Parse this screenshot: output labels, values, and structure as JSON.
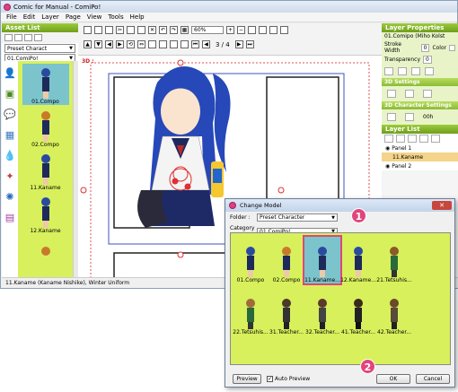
{
  "window": {
    "title": "Comic for Manual - ComiPo!"
  },
  "menu": [
    "File",
    "Edit",
    "Layer",
    "Page",
    "View",
    "Tools",
    "Help"
  ],
  "asset_list": {
    "header": "Asset List",
    "folder_select": "Preset Charact",
    "category_select": "01.ComiPo!",
    "thumbs": [
      "01.Compo",
      "02.Compo",
      "11.Kaname",
      "12.Kaname",
      ""
    ],
    "selected_thumb": "01.Compo"
  },
  "toolbar": {
    "zoom": "60%",
    "page": "3 / 4",
    "label_3d": "3D :"
  },
  "layer_properties": {
    "header": "Layer Properties",
    "layer_name": "01.Comipo (Miho Kolst",
    "stroke_width_label": "Stroke Width",
    "stroke_width_value": "0",
    "color_label": "Color",
    "transparency_label": "Transparency",
    "transparency_value": "0",
    "settings_3d": "3D Settings",
    "char_settings_3d": "3D Character Settings",
    "num_label": "00h"
  },
  "layer_list": {
    "header": "Layer List",
    "items": [
      "Panel 1",
      "11.Kaname",
      "Panel 2"
    ]
  },
  "status": "11.Kaname (Kaname Nishike), Winter Uniform",
  "dialog": {
    "title": "Change Model",
    "folder_label": "Folder :",
    "folder_value": "Preset Character",
    "category_label": "Category :",
    "category_value": "01.ComiPo!",
    "models": [
      "01.Compo",
      "02.Compo",
      "11.Kaname...",
      "12.Kaname...",
      "21.Tetsuhis...",
      "",
      "22.Tetsuhis...",
      "31.Teacher...",
      "32.Teacher...",
      "41.Teacher...",
      "42.Teacher...",
      ""
    ],
    "preview_button": "Preview",
    "auto_preview": "Auto Preview",
    "ok_button": "OK",
    "cancel_button": "Cancel"
  },
  "markers": {
    "one": "1",
    "two": "2"
  }
}
